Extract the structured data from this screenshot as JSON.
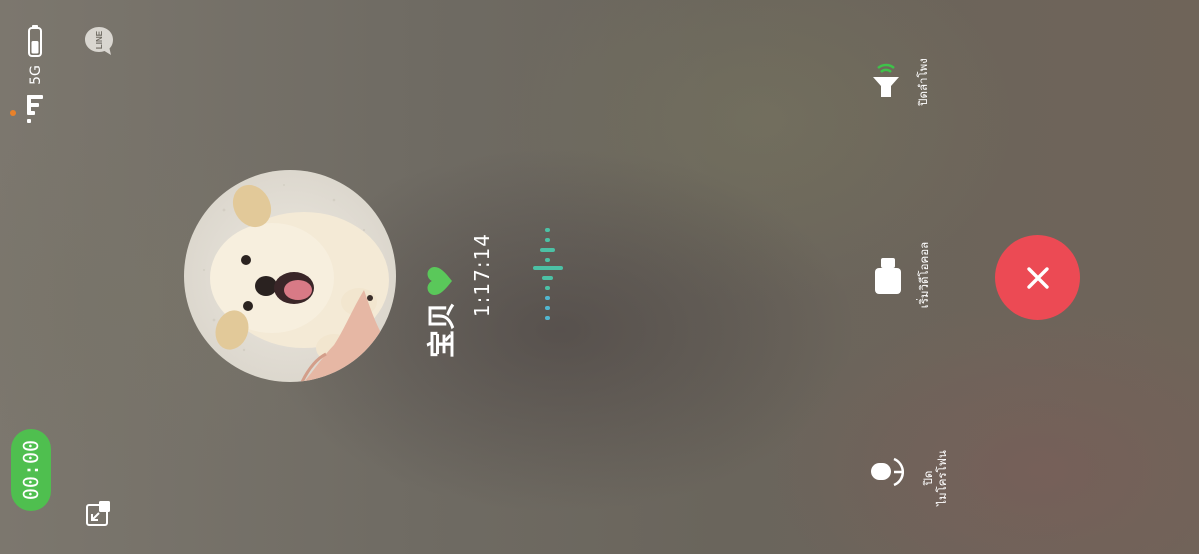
{
  "status_bar": {
    "network": "5G",
    "battery_icon": "battery-icon",
    "signal_icon": "signal-icon",
    "app_badge": "LINE",
    "accent_dot_color": "#e9812a"
  },
  "call": {
    "timer": "00:00",
    "timer_color": "#4fbf4f",
    "contact_name": "宝贝",
    "heart_color": "#5ac85a",
    "duration": "1:17:14"
  },
  "controls": {
    "speaker_label": "ปิดลำโพง",
    "video_label": "เริ่มวิดีโอคอล",
    "mic_label_line1": "ปิด",
    "mic_label_line2": "ไมโครโฟน",
    "end_call_color": "#ec4a54",
    "speaker_active_color": "#3ec24a"
  }
}
